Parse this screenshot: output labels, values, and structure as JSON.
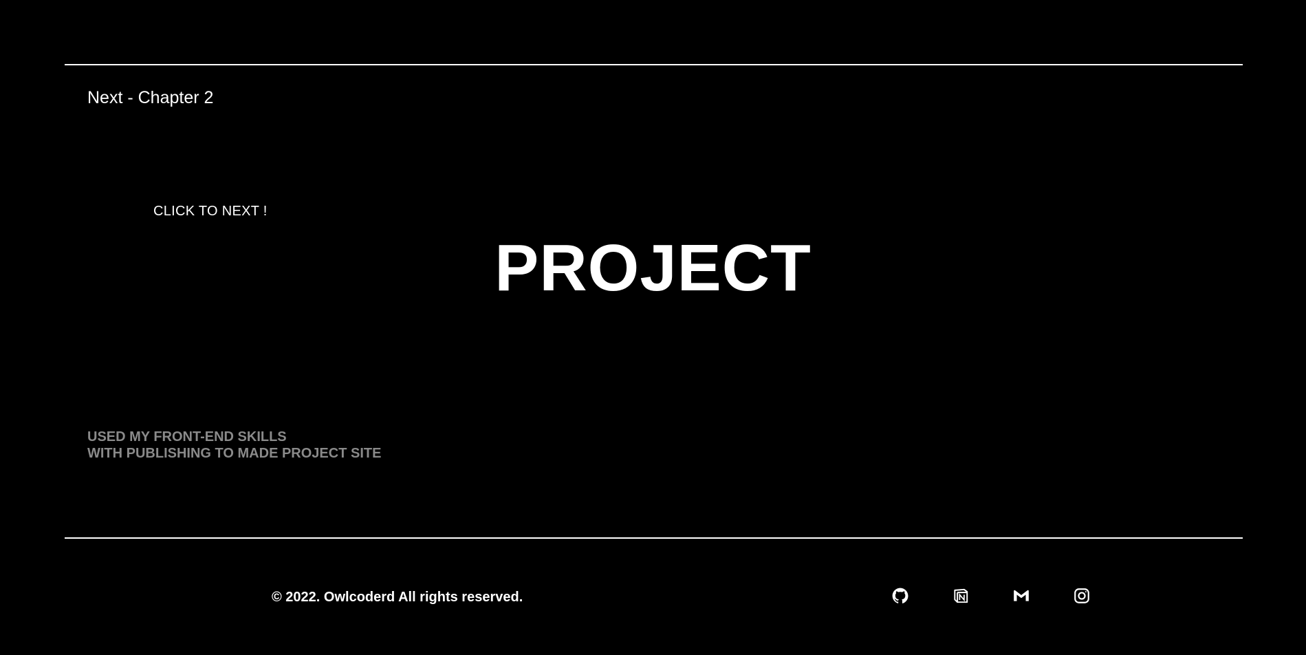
{
  "nav": {
    "next_label": "Next - Chapter 2"
  },
  "hero": {
    "cta_label": "CLICK TO NEXT !",
    "title": "PROJECT",
    "description_line1": "USED MY FRONT-END SKILLS",
    "description_line2": "WITH PUBLISHING TO MADE PROJECT SITE"
  },
  "footer": {
    "copyright": "© 2022. Owlcoderd All rights reserved.",
    "social_icons": [
      "github-icon",
      "notion-icon",
      "gmail-icon",
      "instagram-icon"
    ]
  },
  "colors": {
    "background": "#000000",
    "text": "#ffffff",
    "muted_text": "#8a8a8a",
    "rule": "#ffffff"
  }
}
